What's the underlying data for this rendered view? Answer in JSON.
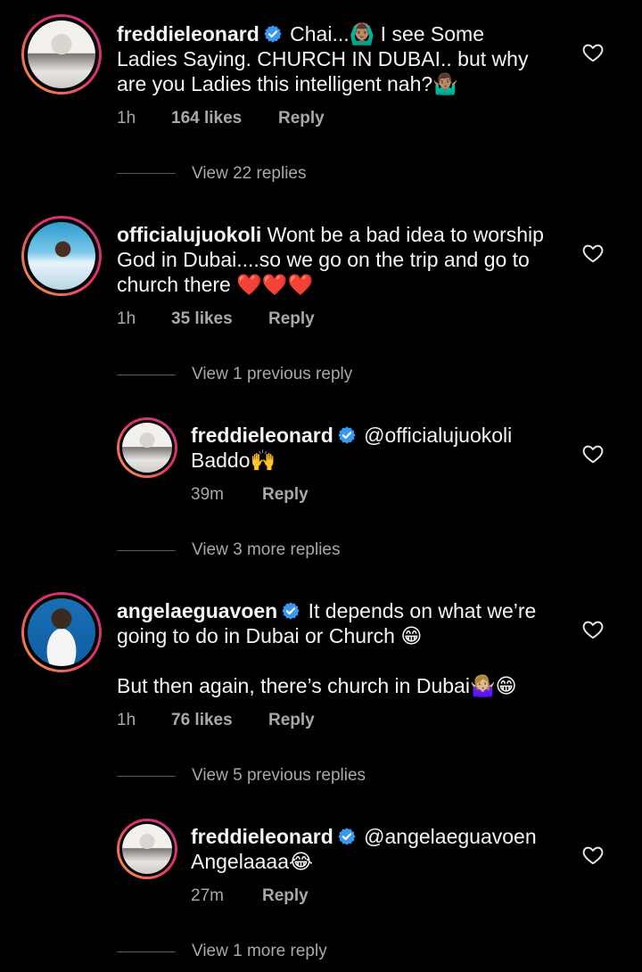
{
  "comments": [
    {
      "username": "freddieleonard",
      "verified": true,
      "text_lines": [
        "Chai...🙆🏽‍♂️ I see Some",
        "Ladies Saying. CHURCH IN DUBAI.. but why",
        "are you Ladies this intelligent nah?🤷🏽‍♂️"
      ],
      "time": "1h",
      "likes": "164 likes",
      "reply": "Reply",
      "view_replies": "View 22 replies"
    },
    {
      "username": "officialujuokoli",
      "verified": false,
      "text_lines": [
        "Wont be a bad idea to worship",
        "God in Dubai....so we go on the trip and go to",
        "church there ❤️❤️❤️"
      ],
      "time": "1h",
      "likes": "35 likes",
      "reply": "Reply",
      "view_replies": "View 1 previous reply"
    },
    {
      "username": "freddieleonard",
      "verified": true,
      "text_lines": [
        "@officialujuokoli",
        "Baddo🙌"
      ],
      "time": "39m",
      "reply": "Reply",
      "view_replies": "View 3 more replies"
    },
    {
      "username": "angelaeguavoen",
      "verified": true,
      "text_lines": [
        "It depends on what we’re",
        "going to do in Dubai or Church 😁",
        "",
        "But then again, there’s church in Dubai🤷🏼‍♀️😁"
      ],
      "time": "1h",
      "likes": "76 likes",
      "reply": "Reply",
      "view_replies": "View 5 previous replies"
    },
    {
      "username": "freddieleonard",
      "verified": true,
      "text_lines": [
        "@angelaeguavoen",
        "Angelaaaa😂"
      ],
      "time": "27m",
      "reply": "Reply",
      "view_replies": "View 1 more reply"
    }
  ],
  "colors": {
    "background": "#000000",
    "text": "#f5f5f5",
    "secondary_text": "#a8a8a8",
    "verified_badge": "#3897f0"
  },
  "icons": {
    "heart": "heart-outline-icon",
    "verified": "verified-badge-icon"
  }
}
